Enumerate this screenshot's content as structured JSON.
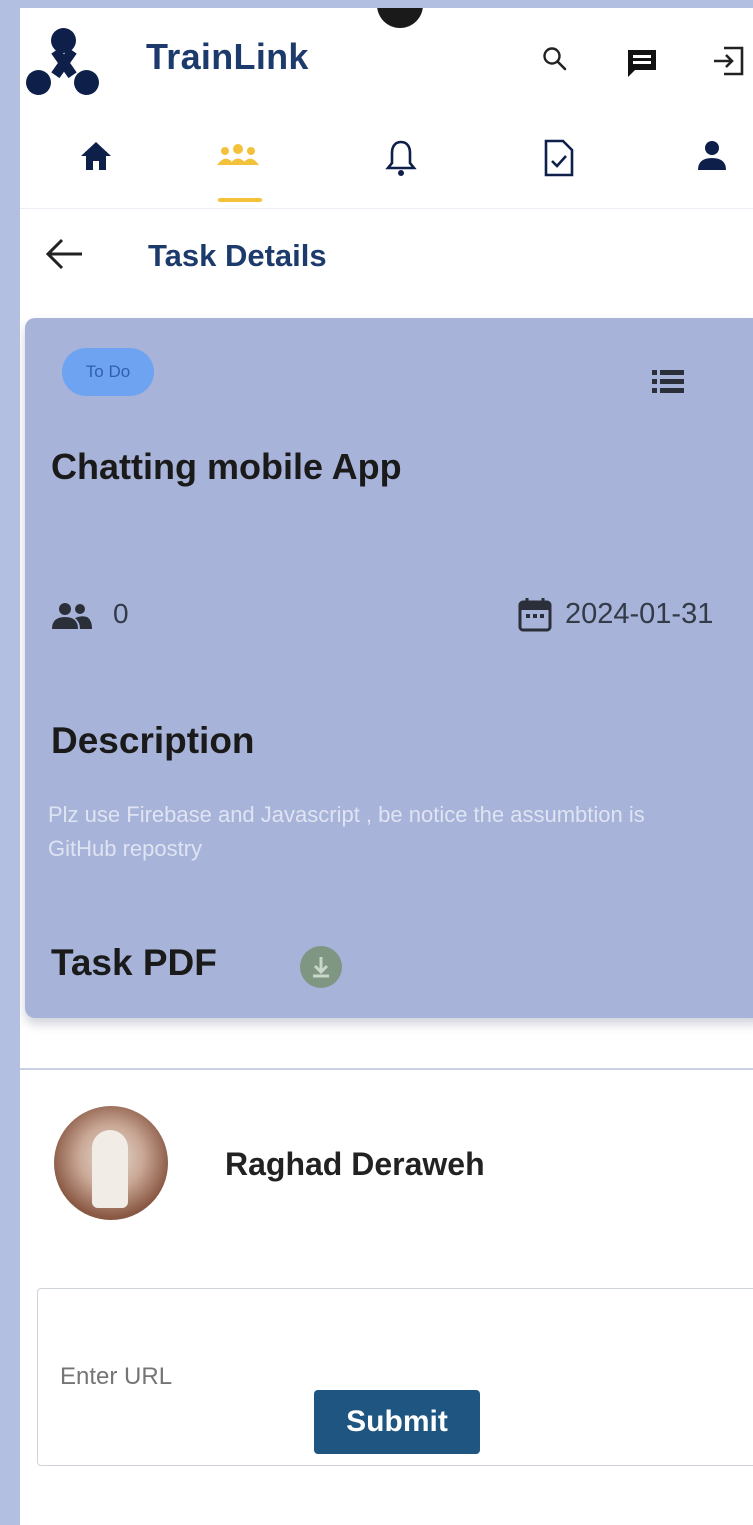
{
  "app": {
    "title": "TrainLink"
  },
  "header_icons": [
    "search-icon",
    "chat-icon",
    "logout-icon"
  ],
  "nav": {
    "items": [
      {
        "icon": "home-icon",
        "active": false
      },
      {
        "icon": "groups-icon",
        "active": true
      },
      {
        "icon": "bell-icon",
        "active": false
      },
      {
        "icon": "task-file-icon",
        "active": false
      },
      {
        "icon": "profile-icon",
        "active": false
      }
    ],
    "active_color": "#f3c23a"
  },
  "page": {
    "title": "Task Details"
  },
  "task": {
    "status": "To Do",
    "title": "Chatting mobile App",
    "members_count": "0",
    "deadline": "2024-01-31",
    "description_heading": "Description",
    "description": "Plz use Firebase and Javascript , be notice the assumbtion is GitHub repostry",
    "pdf_heading": "Task PDF"
  },
  "submission": {
    "user_name": "Raghad Deraweh",
    "url_placeholder": "Enter URL",
    "submit_label": "Submit"
  },
  "colors": {
    "brand": "#1c3a6b",
    "card_background": "#a7b3d8",
    "status_badge": "#6ea3f2",
    "submit_button": "#1f5581"
  }
}
